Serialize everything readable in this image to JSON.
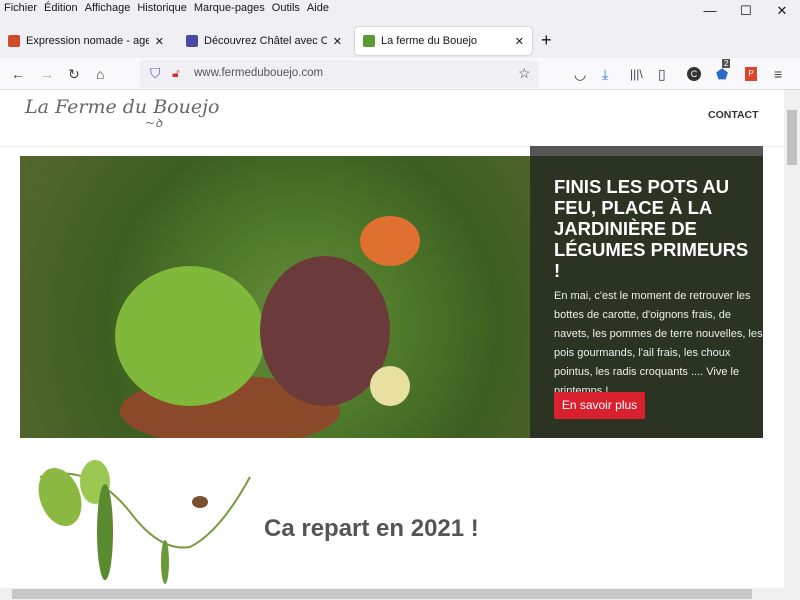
{
  "menu": [
    "Fichier",
    "Édition",
    "Affichage",
    "Historique",
    "Marque-pages",
    "Outils",
    "Aide"
  ],
  "tabs": [
    {
      "title": "Expression nomade - agence de",
      "color": "#d04a2a"
    },
    {
      "title": "Découvrez Châtel avec Chloé |",
      "color": "#4a4aa0"
    },
    {
      "title": "La ferme du Bouejo",
      "color": "#5a9a30"
    }
  ],
  "url": "www.fermedubouejo.com",
  "badge": "2",
  "site": {
    "logo": "La Ferme du Bouejo",
    "nav_contact": "CONTACT",
    "hero_title": "FINIS LES POTS AU FEU, PLACE À LA JARDINIÈRE DE LÉGUMES PRIMEURS !",
    "hero_text": "En mai, c'est le moment de retrouver les bottes de carotte, d'oignons frais, de navets, les pommes de terre nouvelles, les pois gourmands, l'ail frais, les choux pointus, les radis croquants .... Vive le printemps !",
    "hero_button": "En savoir plus",
    "section_title": "Ca repart en 2021 !",
    "accent": "#d9202f"
  }
}
